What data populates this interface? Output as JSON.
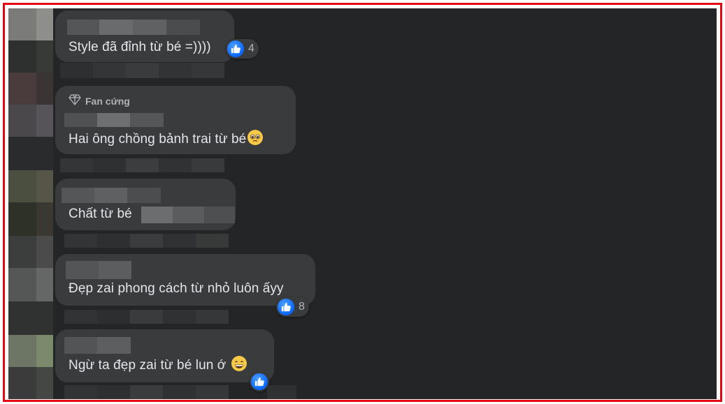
{
  "comments": [
    {
      "text": "Style đã đỉnh từ bé =))))",
      "reaction": {
        "icon": "like-icon",
        "count": "4"
      }
    },
    {
      "badge": "Fan cứng",
      "badge_icon": "diamond-icon",
      "text": "Hai ông chồng bảnh trai từ bé",
      "emoji": "pleading-face-emoji"
    },
    {
      "text": "Chất từ bé"
    },
    {
      "text": "Đẹp zai phong cách từ nhỏ luôn ấyy",
      "reaction": {
        "icon": "like-icon",
        "count": "8"
      }
    },
    {
      "text": "Ngừ ta đẹp zai từ bé lun ớ",
      "emoji": "grinning-face-emoji",
      "reaction": {
        "icon": "like-icon"
      }
    }
  ],
  "colors": {
    "frame_border": "#e30613",
    "background": "#242526",
    "bubble": "#3a3b3c",
    "text": "#e4e6eb",
    "secondary_text": "#b0b3b8",
    "like_blue": "#0866ff"
  }
}
